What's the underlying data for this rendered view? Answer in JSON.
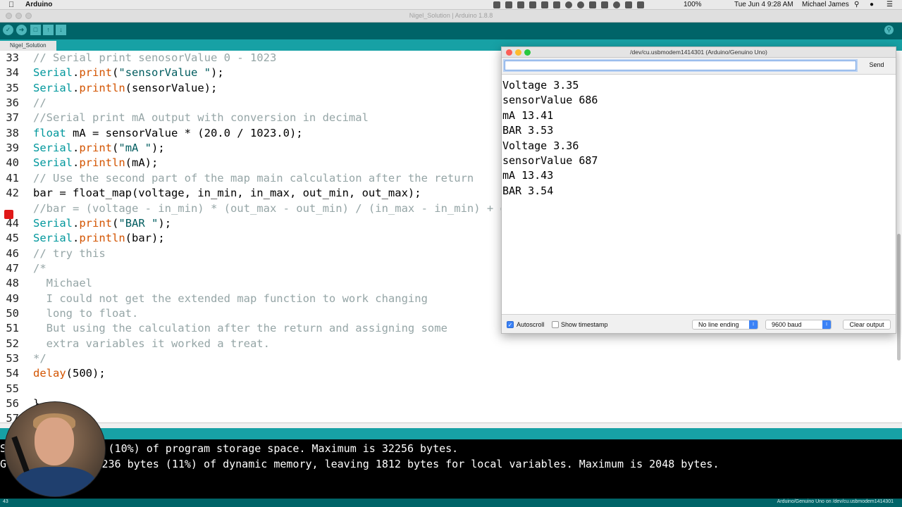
{
  "menubar": {
    "app_name": "Arduino",
    "battery": "100%",
    "datetime": "Tue Jun 4  9:28 AM",
    "user": "Michael James"
  },
  "window": {
    "title": "Nigel_Solution | Arduino 1.8.8"
  },
  "tab": {
    "label": "Nigel_Solution"
  },
  "code": {
    "lines": [
      {
        "n": "33",
        "segments": [
          {
            "t": "// Serial print senosorValue 0 - 1023",
            "c": "comment"
          }
        ]
      },
      {
        "n": "34",
        "segments": [
          {
            "t": "Serial",
            "c": "type"
          },
          {
            "t": ".",
            "c": "plain"
          },
          {
            "t": "print",
            "c": "func"
          },
          {
            "t": "(",
            "c": "plain"
          },
          {
            "t": "\"sensorValue \"",
            "c": "str"
          },
          {
            "t": ");",
            "c": "plain"
          }
        ]
      },
      {
        "n": "35",
        "segments": [
          {
            "t": "Serial",
            "c": "type"
          },
          {
            "t": ".",
            "c": "plain"
          },
          {
            "t": "println",
            "c": "func"
          },
          {
            "t": "(sensorValue);",
            "c": "plain"
          }
        ]
      },
      {
        "n": "36",
        "segments": [
          {
            "t": "//",
            "c": "comment"
          }
        ]
      },
      {
        "n": "37",
        "segments": [
          {
            "t": "//Serial print mA output with conversion in decimal",
            "c": "comment"
          }
        ]
      },
      {
        "n": "38",
        "segments": [
          {
            "t": "float",
            "c": "type"
          },
          {
            "t": " mA = sensorValue * (20.0 / 1023.0);",
            "c": "plain"
          }
        ]
      },
      {
        "n": "39",
        "segments": [
          {
            "t": "Serial",
            "c": "type"
          },
          {
            "t": ".",
            "c": "plain"
          },
          {
            "t": "print",
            "c": "func"
          },
          {
            "t": "(",
            "c": "plain"
          },
          {
            "t": "\"mA \"",
            "c": "str"
          },
          {
            "t": ");",
            "c": "plain"
          }
        ]
      },
      {
        "n": "40",
        "segments": [
          {
            "t": "Serial",
            "c": "type"
          },
          {
            "t": ".",
            "c": "plain"
          },
          {
            "t": "println",
            "c": "func"
          },
          {
            "t": "(mA);",
            "c": "plain"
          }
        ]
      },
      {
        "n": "41",
        "segments": [
          {
            "t": "// Use the second part of the map main calculation after the return",
            "c": "comment"
          }
        ]
      },
      {
        "n": "42",
        "segments": [
          {
            "t": "bar = float_map(voltage, in_min, in_max, out_min, out_max);",
            "c": "plain"
          }
        ]
      },
      {
        "n": "",
        "segments": [
          {
            "t": "//bar = (voltage - in_min) * (out_max - out_min) / (in_max - in_min) + out_min;",
            "c": "comment"
          }
        ]
      },
      {
        "n": "44",
        "segments": [
          {
            "t": "Serial",
            "c": "type"
          },
          {
            "t": ".",
            "c": "plain"
          },
          {
            "t": "print",
            "c": "func"
          },
          {
            "t": "(",
            "c": "plain"
          },
          {
            "t": "\"BAR \"",
            "c": "str"
          },
          {
            "t": ");",
            "c": "plain"
          }
        ]
      },
      {
        "n": "45",
        "segments": [
          {
            "t": "Serial",
            "c": "type"
          },
          {
            "t": ".",
            "c": "plain"
          },
          {
            "t": "println",
            "c": "func"
          },
          {
            "t": "(bar);",
            "c": "plain"
          }
        ]
      },
      {
        "n": "46",
        "segments": [
          {
            "t": "// try this",
            "c": "comment"
          }
        ]
      },
      {
        "n": "47",
        "segments": [
          {
            "t": "/*",
            "c": "comment"
          }
        ]
      },
      {
        "n": "48",
        "segments": [
          {
            "t": "  Michael",
            "c": "comment"
          }
        ]
      },
      {
        "n": "49",
        "segments": [
          {
            "t": "  I could not get the extended map function to work changing",
            "c": "comment"
          }
        ]
      },
      {
        "n": "50",
        "segments": [
          {
            "t": "  long to float.",
            "c": "comment"
          }
        ]
      },
      {
        "n": "51",
        "segments": [
          {
            "t": "  But using the calculation after the return and assigning some",
            "c": "comment"
          }
        ]
      },
      {
        "n": "52",
        "segments": [
          {
            "t": "  extra variables it worked a treat.",
            "c": "comment"
          }
        ]
      },
      {
        "n": "53",
        "segments": [
          {
            "t": "*/",
            "c": "comment"
          }
        ]
      },
      {
        "n": "54",
        "segments": [
          {
            "t": "delay",
            "c": "func"
          },
          {
            "t": "(500);",
            "c": "plain"
          }
        ]
      },
      {
        "n": "55",
        "segments": []
      },
      {
        "n": "56",
        "segments": [
          {
            "t": "}",
            "c": "plain"
          }
        ]
      },
      {
        "n": "57",
        "segments": []
      }
    ]
  },
  "serial_monitor": {
    "title": "/dev/cu.usbmodem1414301 (Arduino/Genuino Uno)",
    "input_value": "",
    "send_label": "Send",
    "output": [
      "Voltage 3.35",
      "sensorValue 686",
      "mA 13.41",
      "BAR 3.53",
      "Voltage 3.36",
      "sensorValue 687",
      "mA 13.43",
      "BAR 3.54"
    ],
    "autoscroll_label": "Autoscroll",
    "autoscroll_checked": true,
    "timestamp_label": "Show timestamp",
    "timestamp_checked": false,
    "line_ending": "No line ending",
    "baud": "9600 baud",
    "clear_label": "Clear output"
  },
  "console": {
    "lines": [
      "Sk         bytes (10%) of program storage space. Maximum is 32256 bytes.",
      "Gl        s use 236 bytes (11%) of dynamic memory, leaving 1812 bytes for local variables. Maximum is 2048 bytes."
    ]
  },
  "footer": {
    "line_number": "43",
    "board": "Arduino/Genuino Uno on /dev/cu.usbmodem1414301"
  },
  "colors": {
    "toolbar": "#006468",
    "tabbar": "#17a1a5",
    "comment": "#95a5a6",
    "func": "#d35400",
    "type": "#00979c",
    "string": "#005c5f"
  }
}
